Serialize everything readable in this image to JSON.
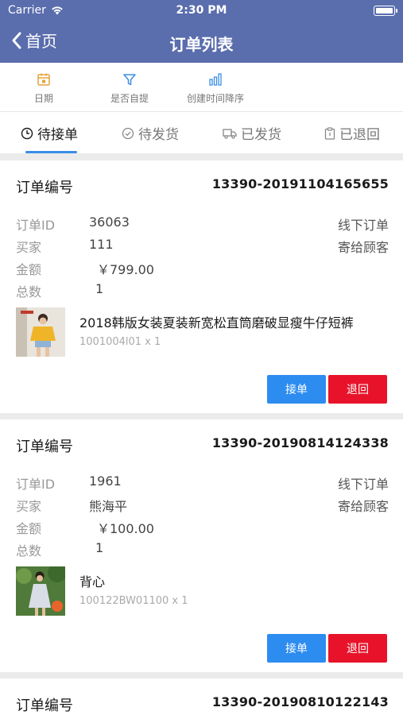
{
  "status_bar": {
    "carrier": "Carrier",
    "time": "2:30 PM"
  },
  "nav": {
    "back_label": "首页",
    "title": "订单列表"
  },
  "filters": [
    {
      "label": "日期",
      "icon": "calendar-icon"
    },
    {
      "label": "是否自提",
      "icon": "filter-icon"
    },
    {
      "label": "创建时间降序",
      "icon": "bar-chart-icon"
    }
  ],
  "tabs": [
    {
      "label": "待接单",
      "icon": "clock-icon",
      "active": true
    },
    {
      "label": "待发货",
      "icon": "check-circle-icon",
      "active": false
    },
    {
      "label": "已发货",
      "icon": "truck-icon",
      "active": false
    },
    {
      "label": "已退回",
      "icon": "clipboard-icon",
      "active": false
    }
  ],
  "orders": [
    {
      "header_label": "订单编号",
      "order_no": "13390-20191104165655",
      "id_label": "订单ID",
      "id_value": "36063",
      "channel": "线下订单",
      "buyer_label": "买家",
      "buyer_value": "111",
      "delivery": "寄给顾客",
      "amount_label": "金额",
      "amount_value": "￥799.00",
      "count_label": "总数",
      "count_value": "1",
      "product_name": "2018韩版女装夏装新宽松直筒磨破显瘦牛仔短裤",
      "product_sku": "1001004l01 x 1",
      "accept_label": "接单",
      "return_label": "退回"
    },
    {
      "header_label": "订单编号",
      "order_no": "13390-20190814124338",
      "id_label": "订单ID",
      "id_value": "1961",
      "channel": "线下订单",
      "buyer_label": "买家",
      "buyer_value": "熊海平",
      "delivery": "寄给顾客",
      "amount_label": "金额",
      "amount_value": "￥100.00",
      "count_label": "总数",
      "count_value": "1",
      "product_name": "背心",
      "product_sku": "100122BW01100 x 1",
      "accept_label": "接单",
      "return_label": "退回"
    },
    {
      "header_label": "订单编号",
      "order_no": "13390-20190810122143"
    }
  ],
  "colors": {
    "nav_bg": "#5a6dad",
    "accent": "#2d8cf0",
    "danger": "#e8132a",
    "tab_indicator": "#3a8ee6"
  }
}
